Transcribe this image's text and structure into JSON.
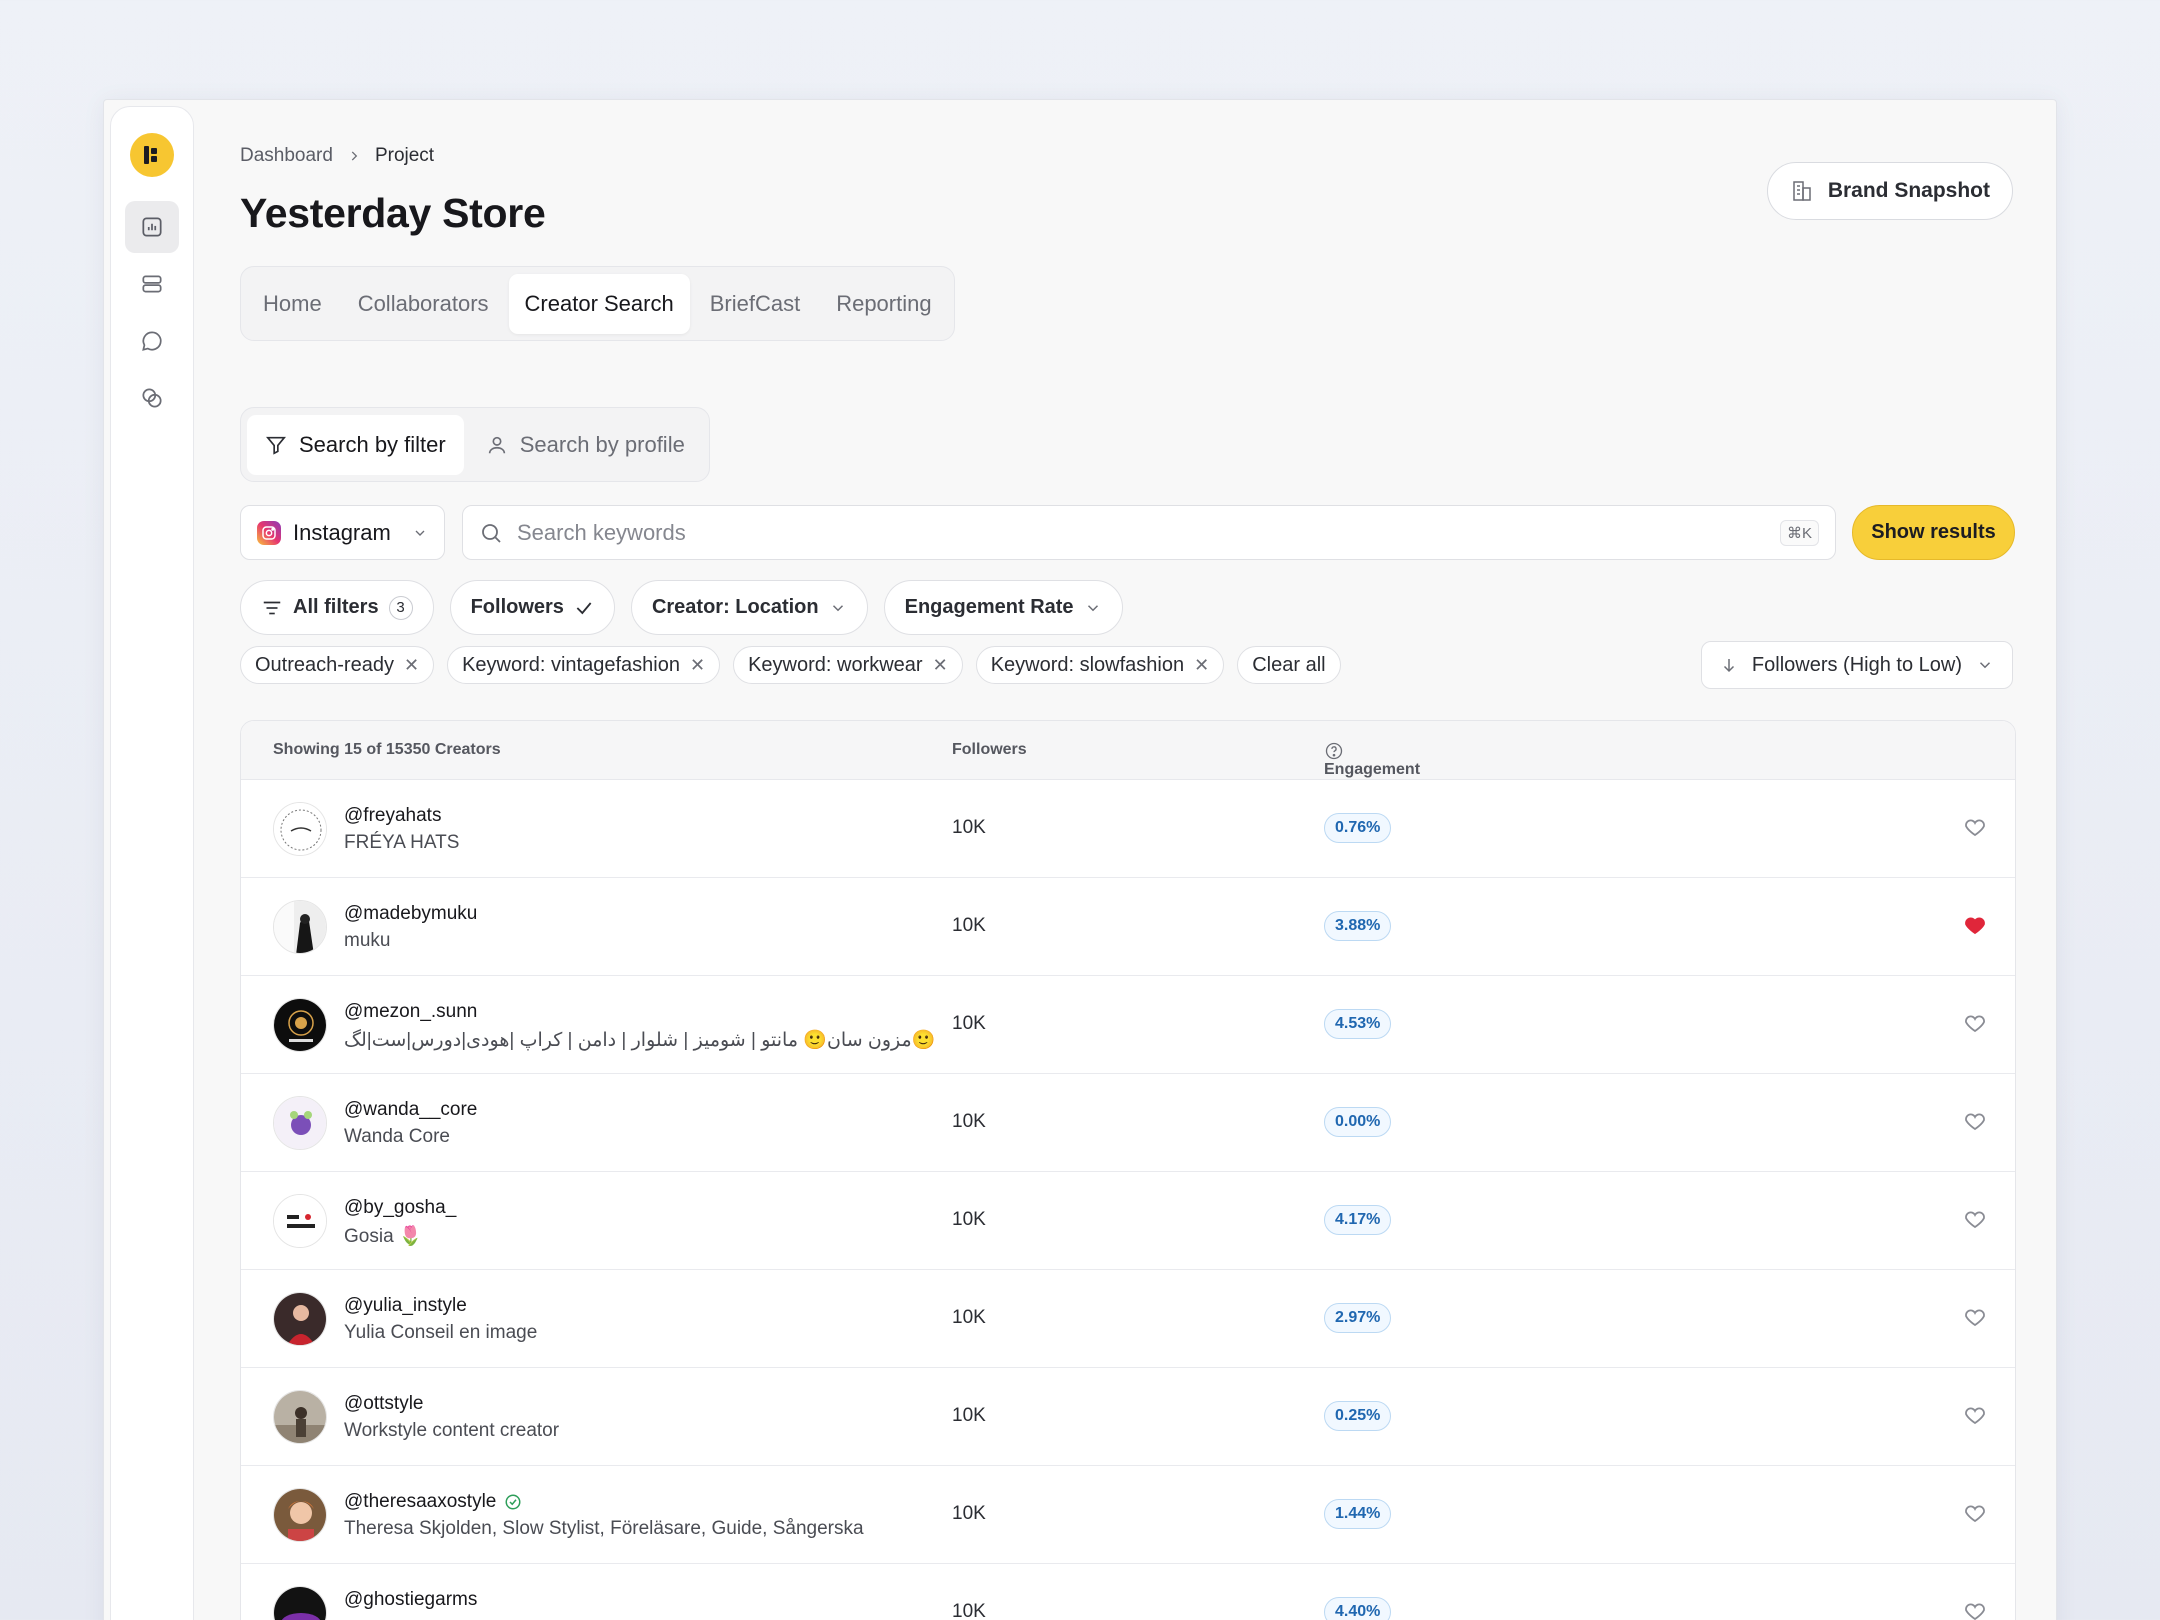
{
  "breadcrumb": {
    "items": [
      "Dashboard",
      "Project"
    ]
  },
  "page": {
    "title": "Yesterday Store"
  },
  "brand_button": {
    "label": "Brand Snapshot"
  },
  "tabs": [
    "Home",
    "Collaborators",
    "Creator Search",
    "BriefCast",
    "Reporting"
  ],
  "active_tab": "Creator Search",
  "search_modes": {
    "by_filter": "Search by filter",
    "by_profile": "Search by profile"
  },
  "platform": {
    "selected": "Instagram"
  },
  "search": {
    "placeholder": "Search keywords",
    "shortcut": "⌘K",
    "submit_label": "Show results"
  },
  "filters": {
    "all_filters": "All filters",
    "all_filters_count": "3",
    "followers": "Followers",
    "location": "Creator: Location",
    "engagement": "Engagement Rate"
  },
  "chips": [
    "Outreach-ready",
    "Keyword: vintagefashion",
    "Keyword: workwear",
    "Keyword: slowfashion"
  ],
  "clear_all": "Clear all",
  "sort": {
    "selected": "Followers (High to Low)"
  },
  "table": {
    "headers": {
      "creators": "Showing 15 of 15350 Creators",
      "followers": "Followers",
      "engagement": "Engagement"
    },
    "rows": [
      {
        "handle": "@freyahats",
        "name": "FRÉYA HATS",
        "followers": "10K",
        "engagement": "0.76%",
        "liked": false,
        "verified": false
      },
      {
        "handle": "@madebymuku",
        "name": "muku",
        "followers": "10K",
        "engagement": "3.88%",
        "liked": true,
        "verified": false
      },
      {
        "handle": "@mezon_.sunn",
        "name": "مزون سان🙂 مانتو | شومیز | شلوار | دامن | کراپ |هودی|دورس|ست|لگ🙂",
        "followers": "10K",
        "engagement": "4.53%",
        "liked": false,
        "verified": false
      },
      {
        "handle": "@wanda__core",
        "name": "Wanda Core",
        "followers": "10K",
        "engagement": "0.00%",
        "liked": false,
        "verified": false
      },
      {
        "handle": "@by_gosha_",
        "name": "Gosia 🌷",
        "followers": "10K",
        "engagement": "4.17%",
        "liked": false,
        "verified": false
      },
      {
        "handle": "@yulia_instyle",
        "name": "Yulia Conseil en image",
        "followers": "10K",
        "engagement": "2.97%",
        "liked": false,
        "verified": false
      },
      {
        "handle": "@ottstyle",
        "name": "Workstyle content creator",
        "followers": "10K",
        "engagement": "0.25%",
        "liked": false,
        "verified": false
      },
      {
        "handle": "@theresaaxostyle",
        "name": "Theresa Skjolden, Slow Stylist, Föreläsare, Guide, Sångerska",
        "followers": "10K",
        "engagement": "1.44%",
        "liked": false,
        "verified": true
      },
      {
        "handle": "@ghostiegarms",
        "name": "",
        "followers": "10K",
        "engagement": "4.40%",
        "liked": false,
        "verified": false
      }
    ]
  },
  "colors": {
    "accent": "#f8cf3a",
    "liked_heart": "#e0263a",
    "engagement_badge": "#2067b0"
  }
}
